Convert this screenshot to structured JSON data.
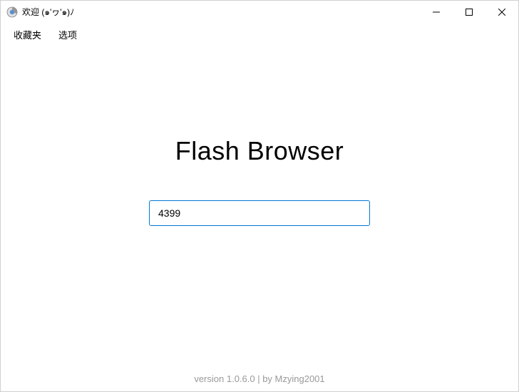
{
  "window": {
    "title": "欢迎 (๑'ヮ'๑)ﾉ"
  },
  "menubar": {
    "favorites": "收藏夹",
    "options": "选项"
  },
  "main": {
    "title": "Flash Browser",
    "search_value": "4399"
  },
  "footer": {
    "text": "version 1.0.6.0 | by Mzying2001"
  }
}
